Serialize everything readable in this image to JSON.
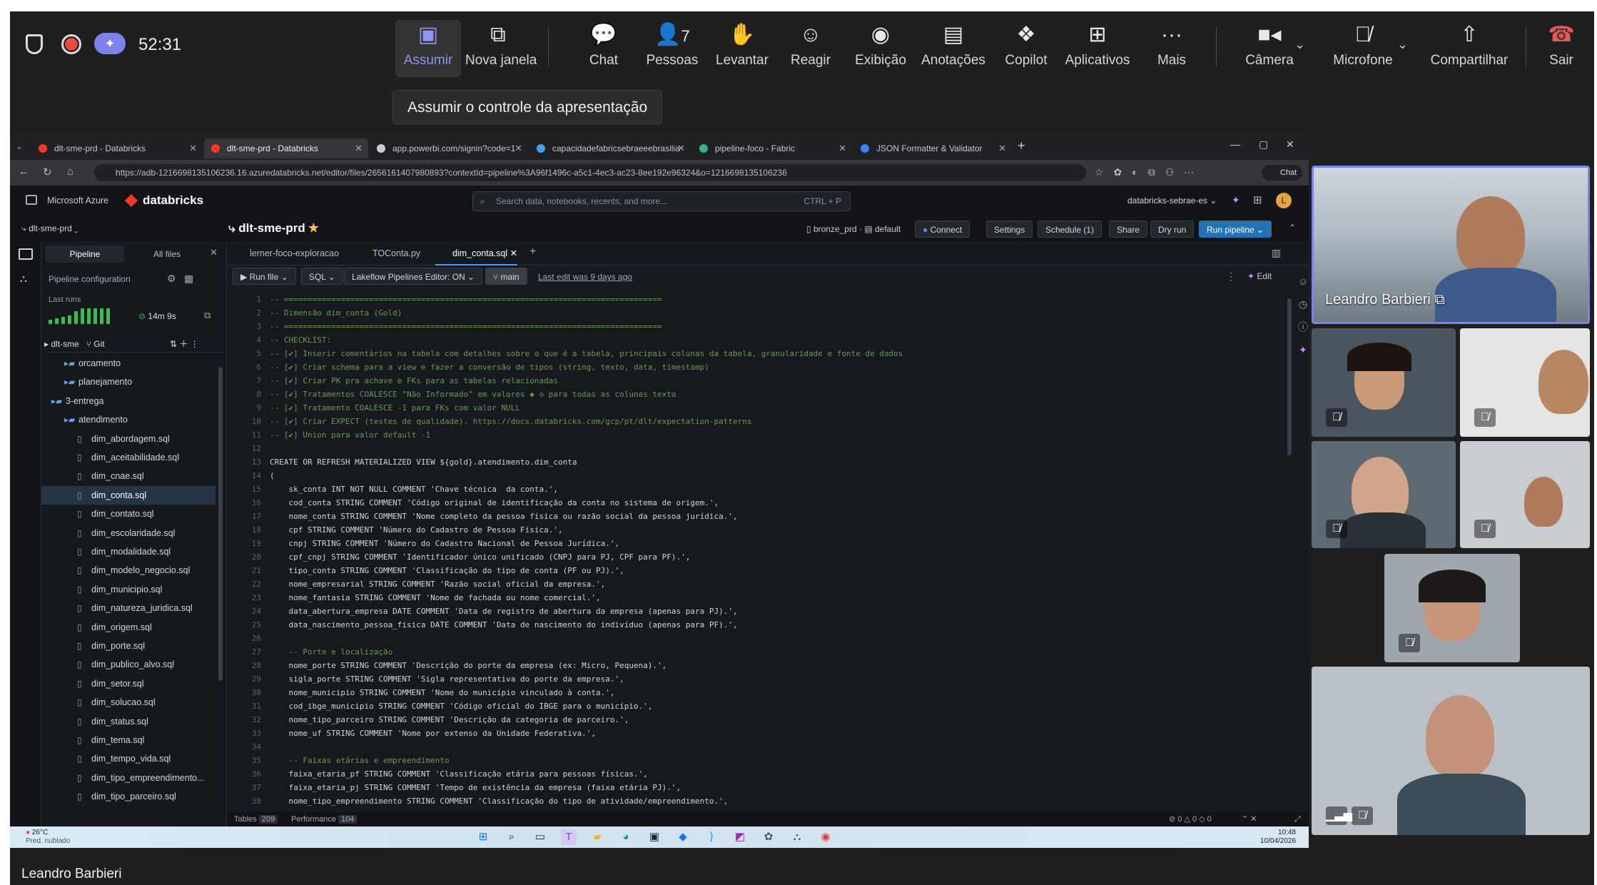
{
  "teams": {
    "timer": "52:31",
    "buttons": [
      {
        "label": "Assumir",
        "icon": "take-control-icon"
      },
      {
        "label": "Nova janela",
        "icon": "new-window-icon"
      },
      {
        "label": "Chat",
        "icon": "chat-icon"
      },
      {
        "label": "Pessoas",
        "icon": "people-icon",
        "count": "7"
      },
      {
        "label": "Levantar",
        "icon": "raise-hand-icon"
      },
      {
        "label": "Reagir",
        "icon": "react-icon"
      },
      {
        "label": "Exibição",
        "icon": "view-icon"
      },
      {
        "label": "Anotações",
        "icon": "notes-icon"
      },
      {
        "label": "Copilot",
        "icon": "copilot-icon"
      },
      {
        "label": "Aplicativos",
        "icon": "apps-icon"
      },
      {
        "label": "Mais",
        "icon": "more-icon"
      },
      {
        "label": "Câmera",
        "icon": "camera-icon"
      },
      {
        "label": "Microfone",
        "icon": "mic-off-icon"
      },
      {
        "label": "Compartilhar",
        "icon": "share-icon"
      },
      {
        "label": "Sair",
        "icon": "leave-icon"
      }
    ],
    "tooltip": "Assumir o controle da apresentação",
    "accent": "#7b83eb",
    "leave_color": "#e05a5a",
    "presenter_name": "Leandro Barbieri",
    "bottom_name": "Leandro Barbieri"
  },
  "browser": {
    "tabs": [
      {
        "label": "dlt-sme-prd - Databricks",
        "color": "#ff3621"
      },
      {
        "label": "dlt-sme-prd - Databricks",
        "color": "#ff3621",
        "active": true
      },
      {
        "label": "app.powerbi.com/signin?code=1",
        "color": "#cccccc"
      },
      {
        "label": "capacidadefabricsebraeeebrasilia",
        "color": "#4a9fe8"
      },
      {
        "label": "pipeline-foco - Fabric",
        "color": "#37b37e"
      },
      {
        "label": "JSON Formatter & Validator",
        "color": "#3b82f6"
      }
    ],
    "url": "https://adb-1216698135106236.16.azuredatabricks.net/editor/files/2656161407980893?contextId=pipeline%3A96f1496c-a5c1-4ec3-ac23-8ee192e96324&o=1216698135106236",
    "chat_label": "Chat"
  },
  "databricks": {
    "brand_azure": "Microsoft Azure",
    "brand": "databricks",
    "search_placeholder": "Search data, notebooks, recents, and more...",
    "search_shortcut": "CTRL + P",
    "workspace": "databricks-sebrae-es",
    "pipeline_selector": "dlt-sme-prd",
    "title": "dlt-sme-prd",
    "catalog": "bronze_prd",
    "schema": "default",
    "actions": [
      "Connect",
      "Settings",
      "Schedule (1)",
      "Share",
      "Dry run",
      "Run pipeline"
    ],
    "side_tabs": [
      "Pipeline",
      "All files"
    ],
    "pipeline_config": "Pipeline configuration",
    "last_runs_label": "Last runs",
    "last_run_duration": "14m 9s",
    "root_folder": "dlt-sme",
    "git_label": "Git",
    "tree": [
      {
        "label": "orcamento",
        "type": "folder",
        "depth": 1
      },
      {
        "label": "planejamento",
        "type": "folder",
        "depth": 1
      },
      {
        "label": "3-entrega",
        "type": "folder",
        "depth": 0
      },
      {
        "label": "atendimento",
        "type": "folder",
        "depth": 1
      },
      {
        "label": "dim_abordagem.sql",
        "type": "file",
        "depth": 2
      },
      {
        "label": "dim_aceitabilidade.sql",
        "type": "file",
        "depth": 2
      },
      {
        "label": "dim_cnae.sql",
        "type": "file",
        "depth": 2
      },
      {
        "label": "dim_conta.sql",
        "type": "file",
        "depth": 2,
        "selected": true
      },
      {
        "label": "dim_contato.sql",
        "type": "file",
        "depth": 2
      },
      {
        "label": "dim_escolaridade.sql",
        "type": "file",
        "depth": 2
      },
      {
        "label": "dim_modalidade.sql",
        "type": "file",
        "depth": 2
      },
      {
        "label": "dim_modelo_negocio.sql",
        "type": "file",
        "depth": 2
      },
      {
        "label": "dim_municipio.sql",
        "type": "file",
        "depth": 2
      },
      {
        "label": "dim_natureza_juridica.sql",
        "type": "file",
        "depth": 2
      },
      {
        "label": "dim_origem.sql",
        "type": "file",
        "depth": 2
      },
      {
        "label": "dim_porte.sql",
        "type": "file",
        "depth": 2
      },
      {
        "label": "dim_publico_alvo.sql",
        "type": "file",
        "depth": 2
      },
      {
        "label": "dim_setor.sql",
        "type": "file",
        "depth": 2
      },
      {
        "label": "dim_solucao.sql",
        "type": "file",
        "depth": 2
      },
      {
        "label": "dim_status.sql",
        "type": "file",
        "depth": 2
      },
      {
        "label": "dim_tema.sql",
        "type": "file",
        "depth": 2
      },
      {
        "label": "dim_tempo_vida.sql",
        "type": "file",
        "depth": 2
      },
      {
        "label": "dim_tipo_empreendimento...",
        "type": "file",
        "depth": 2
      },
      {
        "label": "dim_tipo_parceiro.sql",
        "type": "file",
        "depth": 2
      }
    ],
    "editor_tabs": [
      "lerner-foco-exploracao",
      "TOConta.py",
      "dim_conta.sql"
    ],
    "toolbar": {
      "run_file": "Run file",
      "language": "SQL",
      "lakeflow": "Lakeflow Pipelines Editor: ON",
      "branch": "main",
      "last_edit": "Last edit was 9 days ago",
      "edit": "Edit"
    },
    "status": {
      "tables_label": "Tables",
      "tables_count": "209",
      "performance_label": "Performance",
      "performance_count": "104",
      "problems": "0 △ 0 ◇ 0"
    },
    "code_lines": [
      "-- ================================================================================",
      "-- Dimensão dim_conta (Gold)",
      "-- ================================================================================",
      "-- CHECKLIST:",
      "-- [✔] Inserir comentários na tabela com detalhes sobre o que é a tabela, principais colunas da tabela, granularidade e fonte de dados",
      "-- [✔] Criar schema para a view e fazer a conversão de tipos (string, texto, data, timestamp)",
      "-- [✔] Criar PK pra achave e FKs para as tabelas relacionadas",
      "-- [✔] Tratamentos COALESCE \"Não Informado\" em valores ◆ ◇ para todas as colunas texto",
      "-- [✔] Tratamento COALESCE -1 para FKs com valor NULL",
      "-- [✔] Criar EXPECT (testes de qualidade). https://docs.databricks.com/gcp/pt/dlt/expectation-patterns",
      "-- [✔] Union para valor default -1",
      "",
      "CREATE OR REFRESH MATERIALIZED VIEW ${gold}.atendimento.dim_conta",
      "(",
      "    sk_conta INT NOT NULL COMMENT 'Chave técnica  da conta.',",
      "    cod_conta STRING COMMENT 'Código original de identificação da conta no sistema de origem.',",
      "    nome_conta STRING COMMENT 'Nome completo da pessoa física ou razão social da pessoa jurídica.',",
      "    cpf STRING COMMENT 'Número do Cadastro de Pessoa Física.',",
      "    cnpj STRING COMMENT 'Número do Cadastro Nacional de Pessoa Jurídica.',",
      "    cpf_cnpj STRING COMMENT 'Identificador único unificado (CNPJ para PJ, CPF para PF).',",
      "    tipo_conta STRING COMMENT 'Classificação do tipo de conta (PF ou PJ).',",
      "    nome_empresarial STRING COMMENT 'Razão social oficial da empresa.',",
      "    nome_fantasia STRING COMMENT 'Nome de fachada ou nome comercial.',",
      "    data_abertura_empresa DATE COMMENT 'Data de registro de abertura da empresa (apenas para PJ).',",
      "    data_nascimento_pessoa_fisica DATE COMMENT 'Data de nascimento do indivíduo (apenas para PF).',",
      "",
      "    -- Porte e localização",
      "    nome_porte STRING COMMENT 'Descrição do porte da empresa (ex: Micro, Pequena).',",
      "    sigla_porte STRING COMMENT 'Sigla representativa do porte da empresa.',",
      "    nome_municipio STRING COMMENT 'Nome do município vinculado à conta.',",
      "    cod_ibge_municipio STRING COMMENT 'Código oficial do IBGE para o município.',",
      "    nome_tipo_parceiro STRING COMMENT 'Descrição da categoria de parceiro.',",
      "    nome_uf STRING COMMENT 'Nome por extenso da Unidade Federativa.',",
      "",
      "    -- Faixas etárias e empreendimento",
      "    faixa_etaria_pf STRING COMMENT 'Classificação etária para pessoas físicas.',",
      "    faixa_etaria_pj STRING COMMENT 'Tempo de existência da empresa (faixa etária PJ).',",
      "    nome_tipo_empreendimento STRING COMMENT 'Classificação do tipo de atividade/empreendimento.',"
    ]
  },
  "taskbar": {
    "weather_temp": "26°C",
    "weather_desc": "Pred. nublado",
    "time": "10:48",
    "date": "10/04/2026"
  }
}
